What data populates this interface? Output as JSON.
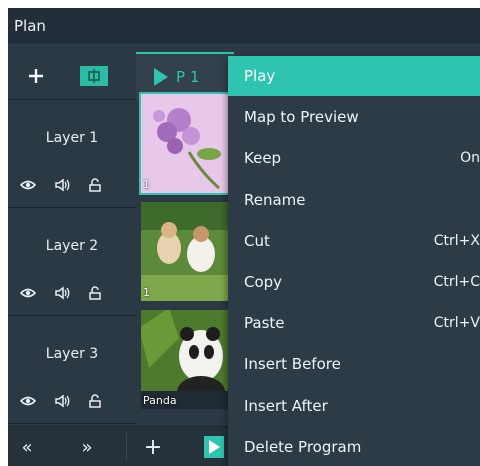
{
  "window": {
    "title": "Plan"
  },
  "toolbar": {
    "add_icon": "plus-icon",
    "fit_icon": "fit-screen-icon"
  },
  "tab": {
    "label": "P 1"
  },
  "layers": [
    {
      "name": "Layer 1",
      "thumb_label": "1",
      "thumb_image": "purple flowers"
    },
    {
      "name": "Layer 2",
      "thumb_label": "1",
      "thumb_image": "children outdoors"
    },
    {
      "name": "Layer 3",
      "thumb_label": "Panda",
      "thumb_image": "panda"
    }
  ],
  "layer_icons": [
    "eye-icon",
    "speaker-icon",
    "lock-icon"
  ],
  "bottom": {
    "prev": "«",
    "next": "»",
    "add": "+"
  },
  "context_menu": {
    "items": [
      {
        "label": "Play",
        "shortcut": ""
      },
      {
        "label": "Map to Preview",
        "shortcut": ""
      },
      {
        "label": "Keep",
        "shortcut": "On"
      },
      {
        "label": "Rename",
        "shortcut": ""
      },
      {
        "label": "Cut",
        "shortcut": "Ctrl+X"
      },
      {
        "label": "Copy",
        "shortcut": "Ctrl+C"
      },
      {
        "label": "Paste",
        "shortcut": "Ctrl+V"
      },
      {
        "label": "Insert Before",
        "shortcut": ""
      },
      {
        "label": "Insert After",
        "shortcut": ""
      },
      {
        "label": "Delete Program",
        "shortcut": ""
      }
    ]
  },
  "colors": {
    "accent": "#2ec4b0",
    "panel": "#2b3945",
    "titlebar": "#222e39"
  }
}
